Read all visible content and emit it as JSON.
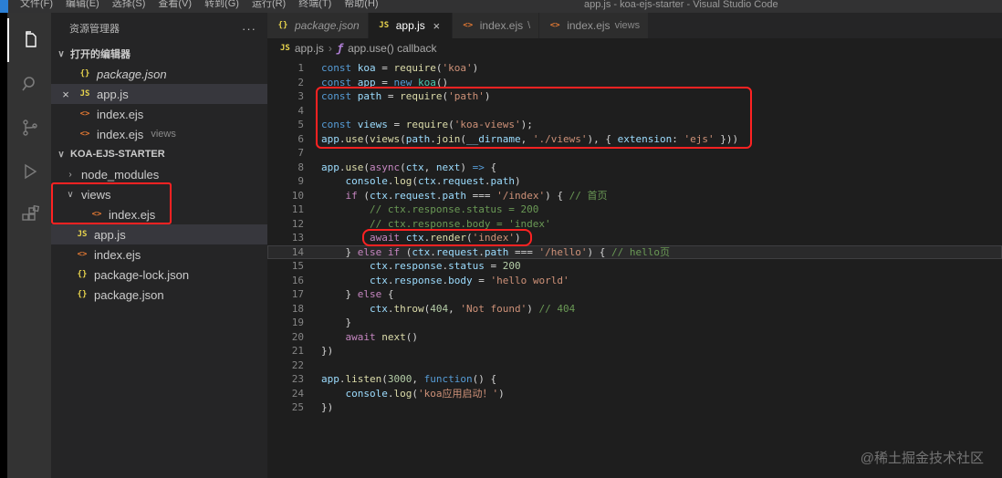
{
  "title_bar": {
    "menus": [
      "文件(F)",
      "编辑(E)",
      "选择(S)",
      "查看(V)",
      "转到(G)",
      "运行(R)",
      "终端(T)",
      "帮助(H)"
    ],
    "window_title": "app.js - koa-ejs-starter - Visual Studio Code"
  },
  "activity_bar": {
    "icons": [
      "explorer-icon",
      "search-icon",
      "source-control-icon",
      "run-debug-icon",
      "extensions-icon"
    ],
    "active": "explorer-icon"
  },
  "sidebar": {
    "title": "资源管理器",
    "more_icon": "···",
    "sections": {
      "open_editors": "打开的编辑器",
      "project": "KOA-EJS-STARTER"
    },
    "open_editors": [
      {
        "icon": "json",
        "label": "package.json",
        "italic": true
      },
      {
        "icon": "js",
        "label": "app.js",
        "active": true,
        "close": "×"
      },
      {
        "icon": "ejs",
        "label": "index.ejs"
      },
      {
        "icon": "ejs",
        "label": "index.ejs",
        "detail": "views"
      }
    ],
    "tree": [
      {
        "chevron": "right",
        "label": "node_modules",
        "indent": 0
      },
      {
        "chevron": "down",
        "label": "views",
        "indent": 0
      },
      {
        "icon": "ejs",
        "label": "index.ejs",
        "indent": 1
      },
      {
        "icon": "js",
        "label": "app.js",
        "indent": 0,
        "selected": true
      },
      {
        "icon": "ejs",
        "label": "index.ejs",
        "indent": 0
      },
      {
        "icon": "json",
        "label": "package-lock.json",
        "indent": 0
      },
      {
        "icon": "json",
        "label": "package.json",
        "indent": 0
      }
    ]
  },
  "tabs": [
    {
      "icon": "json",
      "label": "package.json",
      "italic": true
    },
    {
      "icon": "js",
      "label": "app.js",
      "active": true,
      "close": "×"
    },
    {
      "icon": "ejs",
      "label": "index.ejs",
      "detail": "\\"
    },
    {
      "icon": "ejs",
      "label": "index.ejs",
      "detail": "views"
    }
  ],
  "breadcrumb": {
    "separator": "›",
    "items": [
      {
        "icon": "js",
        "label": "app.js"
      },
      {
        "icon": "symbol-method",
        "label": "app.use() callback"
      }
    ]
  },
  "editor": {
    "active_line": 14,
    "lines": [
      [
        [
          "k",
          "const"
        ],
        [
          "p",
          " "
        ],
        [
          "v",
          "koa"
        ],
        [
          "p",
          " = "
        ],
        [
          "f",
          "require"
        ],
        [
          "p",
          "("
        ],
        [
          "s",
          "'koa'"
        ],
        [
          "p",
          ")"
        ]
      ],
      [
        [
          "k",
          "const"
        ],
        [
          "p",
          " "
        ],
        [
          "v",
          "app"
        ],
        [
          "p",
          " = "
        ],
        [
          "k",
          "new"
        ],
        [
          "p",
          " "
        ],
        [
          "t",
          "koa"
        ],
        [
          "p",
          "()"
        ]
      ],
      [
        [
          "k",
          "const"
        ],
        [
          "p",
          " "
        ],
        [
          "v",
          "path"
        ],
        [
          "p",
          " = "
        ],
        [
          "f",
          "require"
        ],
        [
          "p",
          "("
        ],
        [
          "s",
          "'path'"
        ],
        [
          "p",
          ")"
        ]
      ],
      [],
      [
        [
          "k",
          "const"
        ],
        [
          "p",
          " "
        ],
        [
          "v",
          "views"
        ],
        [
          "p",
          " = "
        ],
        [
          "f",
          "require"
        ],
        [
          "p",
          "("
        ],
        [
          "s",
          "'koa-views'"
        ],
        [
          "p",
          ");"
        ]
      ],
      [
        [
          "v",
          "app"
        ],
        [
          "p",
          "."
        ],
        [
          "f",
          "use"
        ],
        [
          "p",
          "("
        ],
        [
          "f",
          "views"
        ],
        [
          "p",
          "("
        ],
        [
          "v",
          "path"
        ],
        [
          "p",
          "."
        ],
        [
          "f",
          "join"
        ],
        [
          "p",
          "("
        ],
        [
          "v",
          "__dirname"
        ],
        [
          "p",
          ", "
        ],
        [
          "s",
          "'./views'"
        ],
        [
          "p",
          "), { "
        ],
        [
          "v",
          "extension"
        ],
        [
          "p",
          ": "
        ],
        [
          "s",
          "'ejs'"
        ],
        [
          "p",
          " }))"
        ]
      ],
      [],
      [
        [
          "v",
          "app"
        ],
        [
          "p",
          "."
        ],
        [
          "f",
          "use"
        ],
        [
          "p",
          "("
        ],
        [
          "c",
          "async"
        ],
        [
          "p",
          "("
        ],
        [
          "v",
          "ctx"
        ],
        [
          "p",
          ", "
        ],
        [
          "v",
          "next"
        ],
        [
          "p",
          ") "
        ],
        [
          "k",
          "=>"
        ],
        [
          "p",
          " {"
        ]
      ],
      [
        [
          "p",
          "    "
        ],
        [
          "v",
          "console"
        ],
        [
          "p",
          "."
        ],
        [
          "f",
          "log"
        ],
        [
          "p",
          "("
        ],
        [
          "v",
          "ctx"
        ],
        [
          "p",
          "."
        ],
        [
          "v",
          "request"
        ],
        [
          "p",
          "."
        ],
        [
          "v",
          "path"
        ],
        [
          "p",
          ")"
        ]
      ],
      [
        [
          "p",
          "    "
        ],
        [
          "c",
          "if"
        ],
        [
          "p",
          " ("
        ],
        [
          "v",
          "ctx"
        ],
        [
          "p",
          "."
        ],
        [
          "v",
          "request"
        ],
        [
          "p",
          "."
        ],
        [
          "v",
          "path"
        ],
        [
          "p",
          " === "
        ],
        [
          "s",
          "'/index'"
        ],
        [
          "p",
          ") { "
        ],
        [
          "m",
          "// 首页"
        ]
      ],
      [
        [
          "p",
          "        "
        ],
        [
          "m",
          "// ctx.response.status = 200"
        ]
      ],
      [
        [
          "p",
          "        "
        ],
        [
          "m",
          "// ctx.response.body = 'index'"
        ]
      ],
      [
        [
          "p",
          "        "
        ],
        [
          "c",
          "await"
        ],
        [
          "p",
          " "
        ],
        [
          "v",
          "ctx"
        ],
        [
          "p",
          "."
        ],
        [
          "f",
          "render"
        ],
        [
          "p",
          "("
        ],
        [
          "s",
          "'index'"
        ],
        [
          "p",
          ")"
        ]
      ],
      [
        [
          "p",
          "    } "
        ],
        [
          "c",
          "else"
        ],
        [
          "p",
          " "
        ],
        [
          "c",
          "if"
        ],
        [
          "p",
          " ("
        ],
        [
          "v",
          "ctx"
        ],
        [
          "p",
          "."
        ],
        [
          "v",
          "request"
        ],
        [
          "p",
          "."
        ],
        [
          "v",
          "path"
        ],
        [
          "p",
          " === "
        ],
        [
          "s",
          "'/hello'"
        ],
        [
          "p",
          ") { "
        ],
        [
          "m",
          "// hello页"
        ]
      ],
      [
        [
          "p",
          "        "
        ],
        [
          "v",
          "ctx"
        ],
        [
          "p",
          "."
        ],
        [
          "v",
          "response"
        ],
        [
          "p",
          "."
        ],
        [
          "v",
          "status"
        ],
        [
          "p",
          " = "
        ],
        [
          "n",
          "200"
        ]
      ],
      [
        [
          "p",
          "        "
        ],
        [
          "v",
          "ctx"
        ],
        [
          "p",
          "."
        ],
        [
          "v",
          "response"
        ],
        [
          "p",
          "."
        ],
        [
          "v",
          "body"
        ],
        [
          "p",
          " = "
        ],
        [
          "s",
          "'hello world'"
        ]
      ],
      [
        [
          "p",
          "    } "
        ],
        [
          "c",
          "else"
        ],
        [
          "p",
          " {"
        ]
      ],
      [
        [
          "p",
          "        "
        ],
        [
          "v",
          "ctx"
        ],
        [
          "p",
          "."
        ],
        [
          "f",
          "throw"
        ],
        [
          "p",
          "("
        ],
        [
          "n",
          "404"
        ],
        [
          "p",
          ", "
        ],
        [
          "s",
          "'Not found'"
        ],
        [
          "p",
          ") "
        ],
        [
          "m",
          "// 404"
        ]
      ],
      [
        [
          "p",
          "    }"
        ]
      ],
      [
        [
          "p",
          "    "
        ],
        [
          "c",
          "await"
        ],
        [
          "p",
          " "
        ],
        [
          "f",
          "next"
        ],
        [
          "p",
          "()"
        ]
      ],
      [
        [
          "p",
          "})"
        ]
      ],
      [],
      [
        [
          "v",
          "app"
        ],
        [
          "p",
          "."
        ],
        [
          "f",
          "listen"
        ],
        [
          "p",
          "("
        ],
        [
          "n",
          "3000"
        ],
        [
          "p",
          ", "
        ],
        [
          "k",
          "function"
        ],
        [
          "p",
          "() {"
        ]
      ],
      [
        [
          "p",
          "    "
        ],
        [
          "v",
          "console"
        ],
        [
          "p",
          "."
        ],
        [
          "f",
          "log"
        ],
        [
          "p",
          "("
        ],
        [
          "s",
          "'koa应用启动！'"
        ],
        [
          "p",
          ")"
        ]
      ],
      [
        [
          "p",
          "})"
        ]
      ]
    ]
  },
  "watermark": "@稀土掘金技术社区"
}
